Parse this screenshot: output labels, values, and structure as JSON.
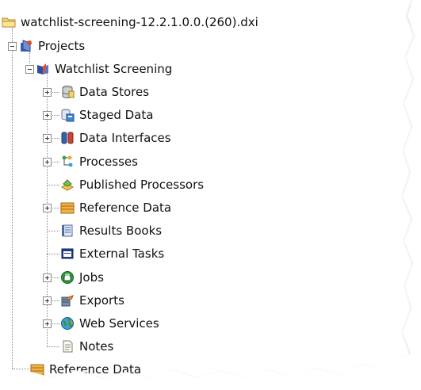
{
  "root": {
    "label": "watchlist-screening-12.2.1.0.0.(260).dxi",
    "icon": "folder-icon"
  },
  "projects": {
    "label": "Projects",
    "icon": "projects-icon"
  },
  "project": {
    "label": "Watchlist Screening",
    "icon": "project-book-icon"
  },
  "items": [
    {
      "label": "Data Stores",
      "icon": "data-stores-icon",
      "expandable": true
    },
    {
      "label": "Staged Data",
      "icon": "staged-data-icon",
      "expandable": true
    },
    {
      "label": "Data Interfaces",
      "icon": "data-interfaces-icon",
      "expandable": true
    },
    {
      "label": "Processes",
      "icon": "processes-icon",
      "expandable": true
    },
    {
      "label": "Published Processors",
      "icon": "published-processors-icon",
      "expandable": false
    },
    {
      "label": "Reference Data",
      "icon": "reference-data-icon",
      "expandable": true
    },
    {
      "label": "Results Books",
      "icon": "results-books-icon",
      "expandable": false
    },
    {
      "label": "External Tasks",
      "icon": "external-tasks-icon",
      "expandable": false
    },
    {
      "label": "Jobs",
      "icon": "jobs-icon",
      "expandable": true
    },
    {
      "label": "Exports",
      "icon": "exports-icon",
      "expandable": true
    },
    {
      "label": "Web Services",
      "icon": "web-services-icon",
      "expandable": true
    },
    {
      "label": "Notes",
      "icon": "notes-icon",
      "expandable": false
    }
  ],
  "bottom": {
    "label": "Reference Data",
    "icon": "reference-data-icon"
  }
}
